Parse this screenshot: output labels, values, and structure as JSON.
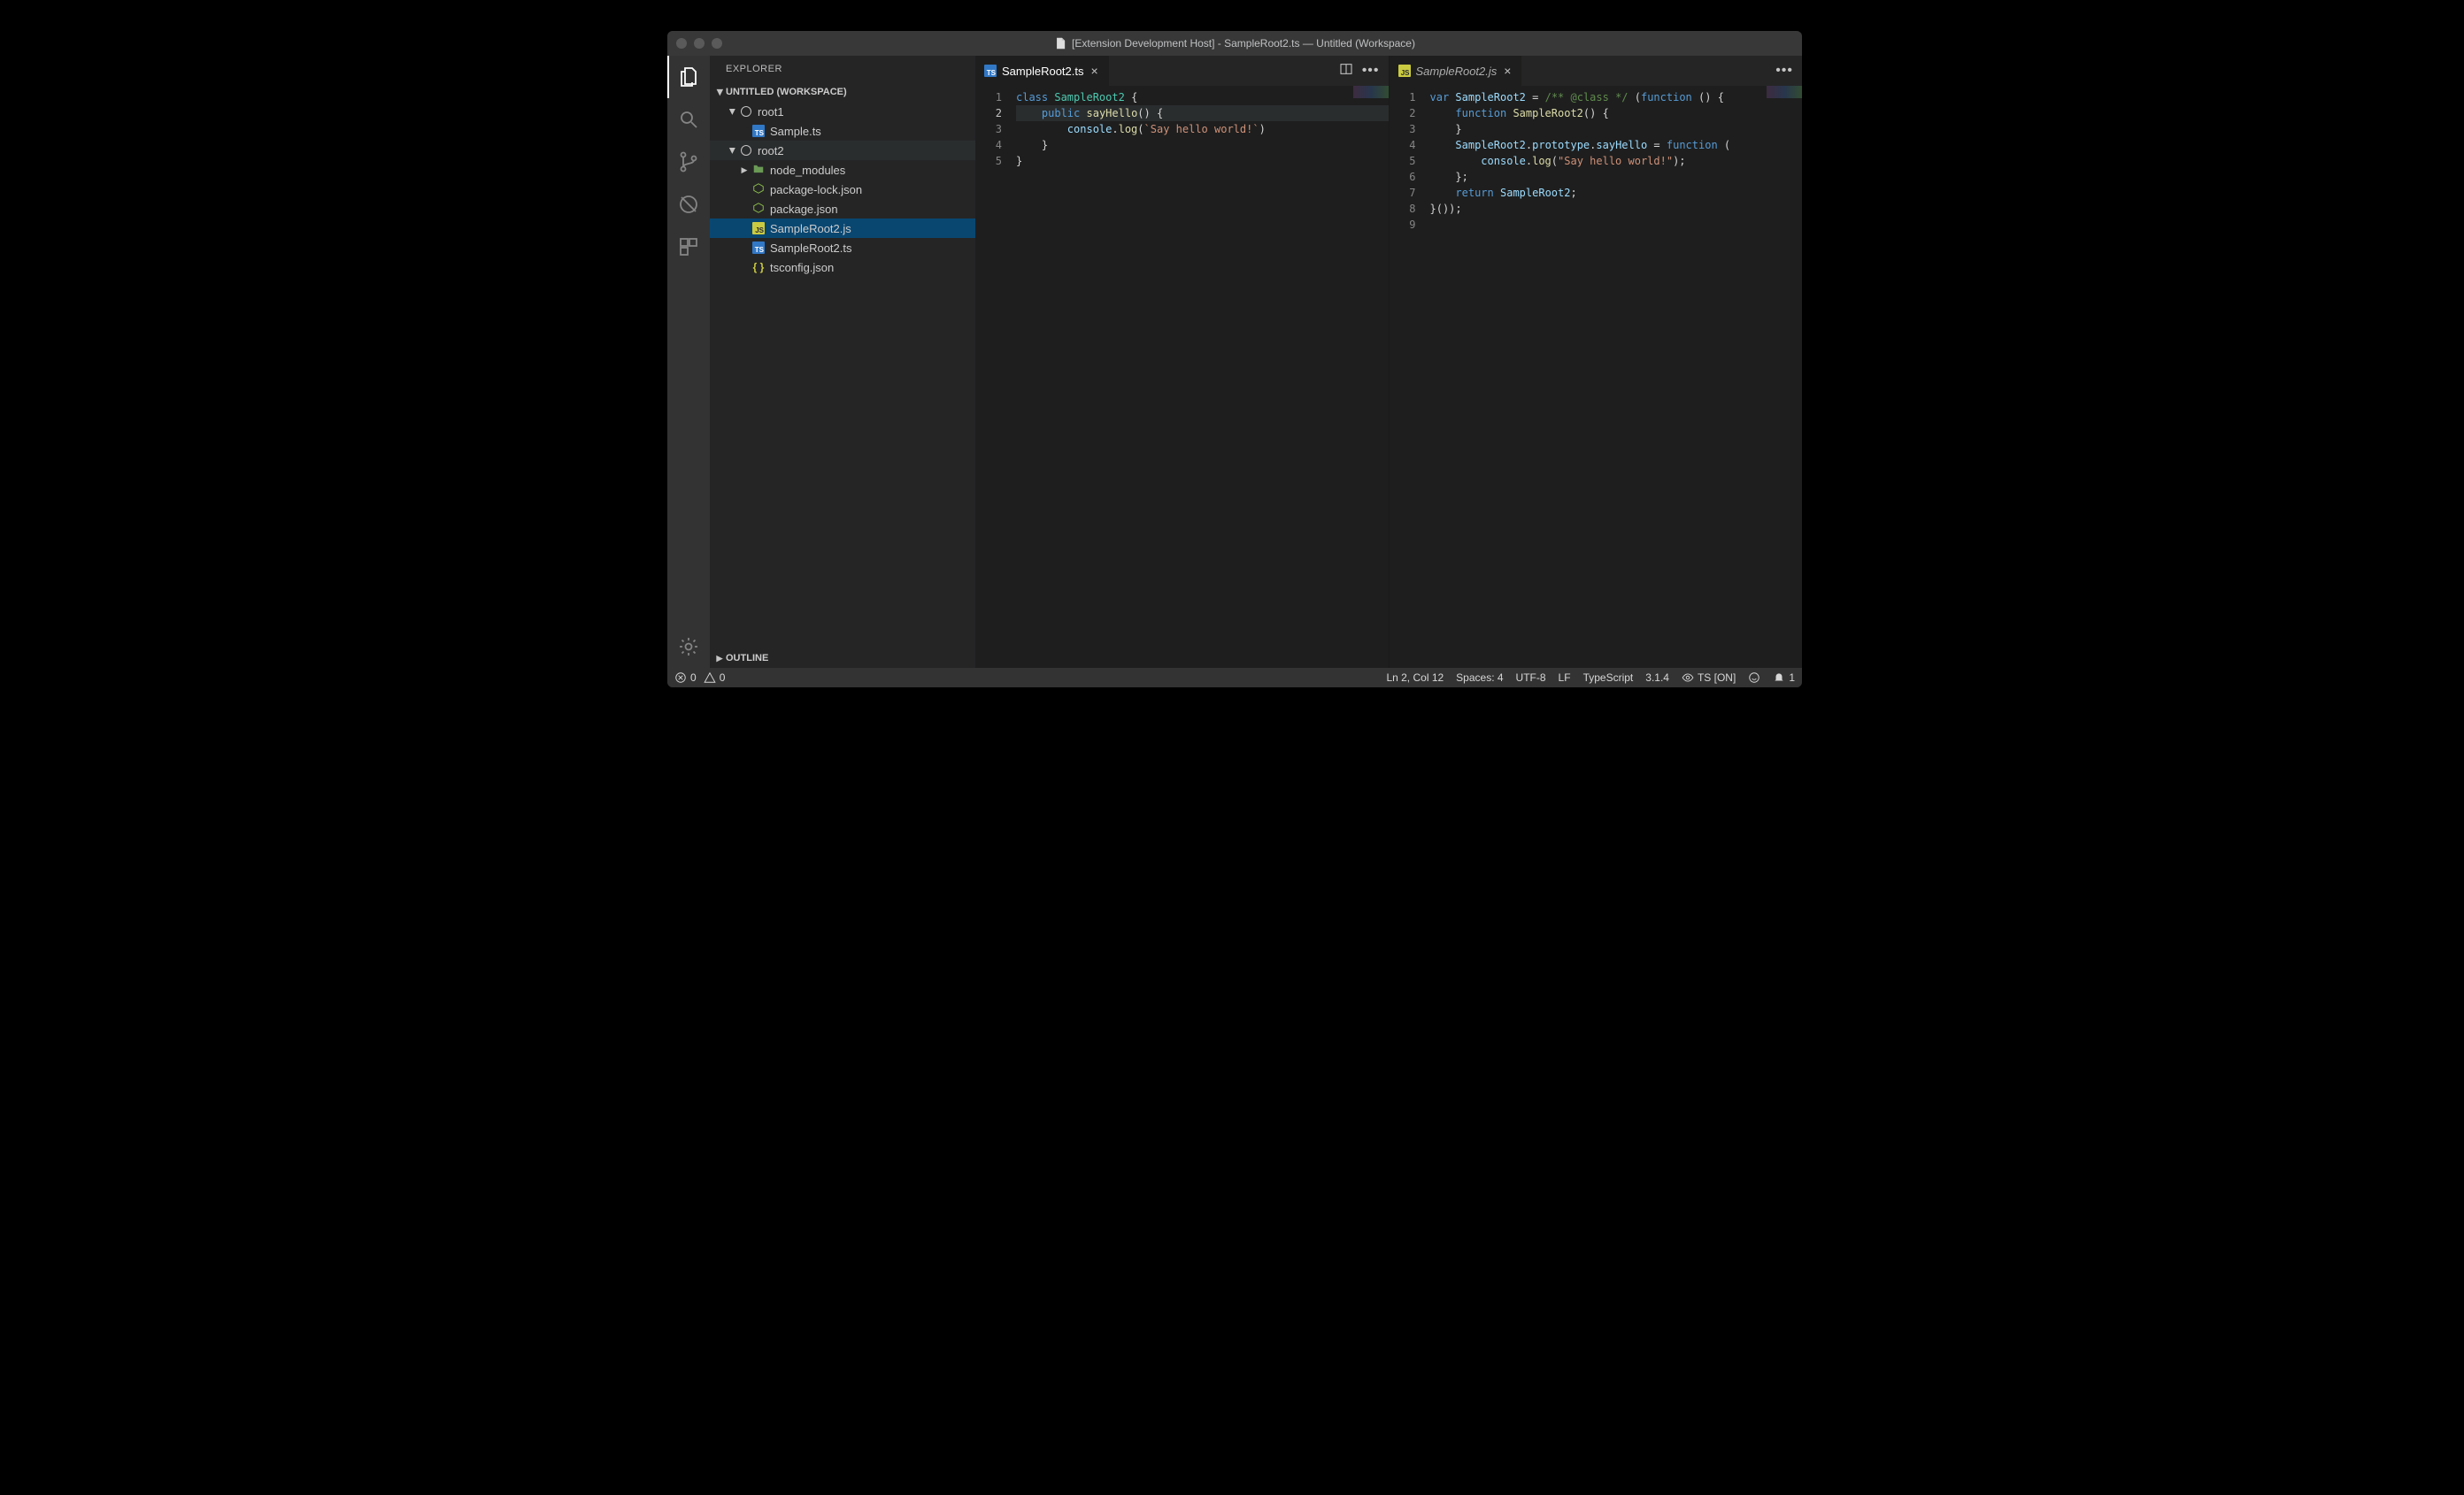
{
  "titlebar": {
    "title": "[Extension Development Host] - SampleRoot2.ts — Untitled (Workspace)"
  },
  "activitybar": {
    "items": [
      "files",
      "search",
      "scm",
      "debug",
      "extensions"
    ]
  },
  "sidebar": {
    "header": "EXPLORER",
    "workspace_header": "UNTITLED (WORKSPACE)",
    "outline_header": "OUTLINE",
    "tree": [
      {
        "name": "root1",
        "kind": "root",
        "expanded": true,
        "depth": 0
      },
      {
        "name": "Sample.ts",
        "kind": "ts",
        "depth": 1
      },
      {
        "name": "root2",
        "kind": "root",
        "expanded": true,
        "depth": 0,
        "gray": true
      },
      {
        "name": "node_modules",
        "kind": "folder",
        "expanded": false,
        "depth": 1
      },
      {
        "name": "package-lock.json",
        "kind": "npm",
        "depth": 1
      },
      {
        "name": "package.json",
        "kind": "npm",
        "depth": 1
      },
      {
        "name": "SampleRoot2.js",
        "kind": "js",
        "depth": 1,
        "selected": true
      },
      {
        "name": "SampleRoot2.ts",
        "kind": "ts",
        "depth": 1
      },
      {
        "name": "tsconfig.json",
        "kind": "json",
        "depth": 1
      }
    ]
  },
  "editors": {
    "left": {
      "tab": {
        "label": "SampleRoot2.ts",
        "kind": "ts",
        "close": "×"
      },
      "current_line": 2,
      "lines": [
        {
          "n": 1,
          "html": "<span class='kw'>class</span> <span class='cls'>SampleRoot2</span> <span class='pun'>{</span>"
        },
        {
          "n": 2,
          "html": "    <span class='kw'>public</span> <span class='fn'>sayHello</span><span class='pun'>() {</span>"
        },
        {
          "n": 3,
          "html": "        <span class='obj'>console</span><span class='pun'>.</span><span class='fn'>log</span><span class='pun'>(</span><span class='str'>`Say hello world!`</span><span class='pun'>)</span>"
        },
        {
          "n": 4,
          "html": "    <span class='pun'>}</span>"
        },
        {
          "n": 5,
          "html": "<span class='pun'>}</span>"
        }
      ]
    },
    "right": {
      "tab": {
        "label": "SampleRoot2.js",
        "kind": "js",
        "italic": true,
        "close": "×"
      },
      "lines": [
        {
          "n": 1,
          "html": "<span class='kw'>var</span> <span class='obj'>SampleRoot2</span> = <span class='cm'>/** @class */</span> <span class='pun'>(</span><span class='kw'>function</span> <span class='pun'>() {</span>"
        },
        {
          "n": 2,
          "html": "    <span class='kw'>function</span> <span class='fn'>SampleRoot2</span><span class='pun'>() {</span>"
        },
        {
          "n": 3,
          "html": "    <span class='pun'>}</span>"
        },
        {
          "n": 4,
          "html": "    <span class='obj'>SampleRoot2</span><span class='pun'>.</span><span class='obj'>prototype</span><span class='pun'>.</span><span class='obj'>sayHello</span> = <span class='kw'>function</span> <span class='pun'>(</span>"
        },
        {
          "n": 5,
          "html": "        <span class='obj'>console</span><span class='pun'>.</span><span class='fn'>log</span><span class='pun'>(</span><span class='str'>\"Say hello world!\"</span><span class='pun'>);</span>"
        },
        {
          "n": 6,
          "html": "    <span class='pun'>};</span>"
        },
        {
          "n": 7,
          "html": "    <span class='kw'>return</span> <span class='obj'>SampleRoot2</span><span class='pun'>;</span>"
        },
        {
          "n": 8,
          "html": "<span class='pun'>}());</span>"
        },
        {
          "n": 9,
          "html": ""
        }
      ]
    }
  },
  "statusbar": {
    "errors": "0",
    "warnings": "0",
    "cursor": "Ln 2, Col 12",
    "spaces": "Spaces: 4",
    "encoding": "UTF-8",
    "eol": "LF",
    "language": "TypeScript",
    "version": "3.1.4",
    "ts_status": "TS [ON]",
    "bell": "1"
  }
}
